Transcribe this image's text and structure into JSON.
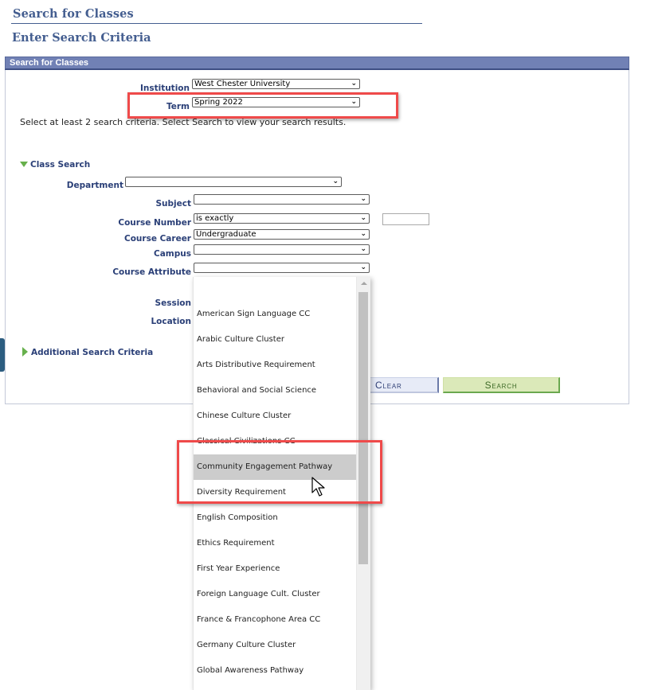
{
  "page": {
    "title": "Search for Classes",
    "subtitle": "Enter Search Criteria"
  },
  "panel": {
    "header": "Search for Classes",
    "hint": "Select at least 2 search criteria. Select Search to view your search results."
  },
  "fields": {
    "institution": {
      "label": "Institution",
      "value": "West Chester University"
    },
    "term": {
      "label": "Term",
      "value": "Spring 2022"
    },
    "department": {
      "label": "Department",
      "value": ""
    },
    "subject": {
      "label": "Subject",
      "value": ""
    },
    "course_number": {
      "label": "Course Number",
      "operator": "is exactly",
      "value": ""
    },
    "course_career": {
      "label": "Course Career",
      "value": "Undergraduate"
    },
    "campus": {
      "label": "Campus",
      "value": ""
    },
    "course_attribute": {
      "label": "Course Attribute",
      "value": ""
    },
    "session": {
      "label": "Session"
    },
    "location": {
      "label": "Location"
    }
  },
  "sections": {
    "class_search": "Class Search",
    "additional": "Additional Search Criteria"
  },
  "buttons": {
    "clear": "Clear",
    "search": "Search"
  },
  "dropdown": {
    "hovered_index": 7,
    "options": [
      "",
      "American Sign Language CC",
      "Arabic Culture Cluster",
      "Arts Distributive Requirement",
      "Behavioral and Social Science",
      "Chinese Culture Cluster",
      "Classical Civilizations CC",
      "Community Engagement Pathway",
      "Diversity Requirement",
      "English Composition",
      "Ethics Requirement",
      "First Year Experience",
      "Foreign Language Cult. Cluster",
      "France & Francophone Area CC",
      "Germany Culture Cluster",
      "Global Awareness Pathway"
    ]
  },
  "icons": {
    "chevron": "chevron-down-icon",
    "expanded": "triangle-down-icon",
    "collapsed": "triangle-right-icon",
    "cursor": "mouse-pointer-icon"
  },
  "colors": {
    "title": "#445e90",
    "header_bg": "#7181b5",
    "label": "#2a3f77",
    "highlight": "#ef4a4a",
    "search_btn": "#dbe9b9",
    "clear_btn": "#e7ebf7"
  }
}
